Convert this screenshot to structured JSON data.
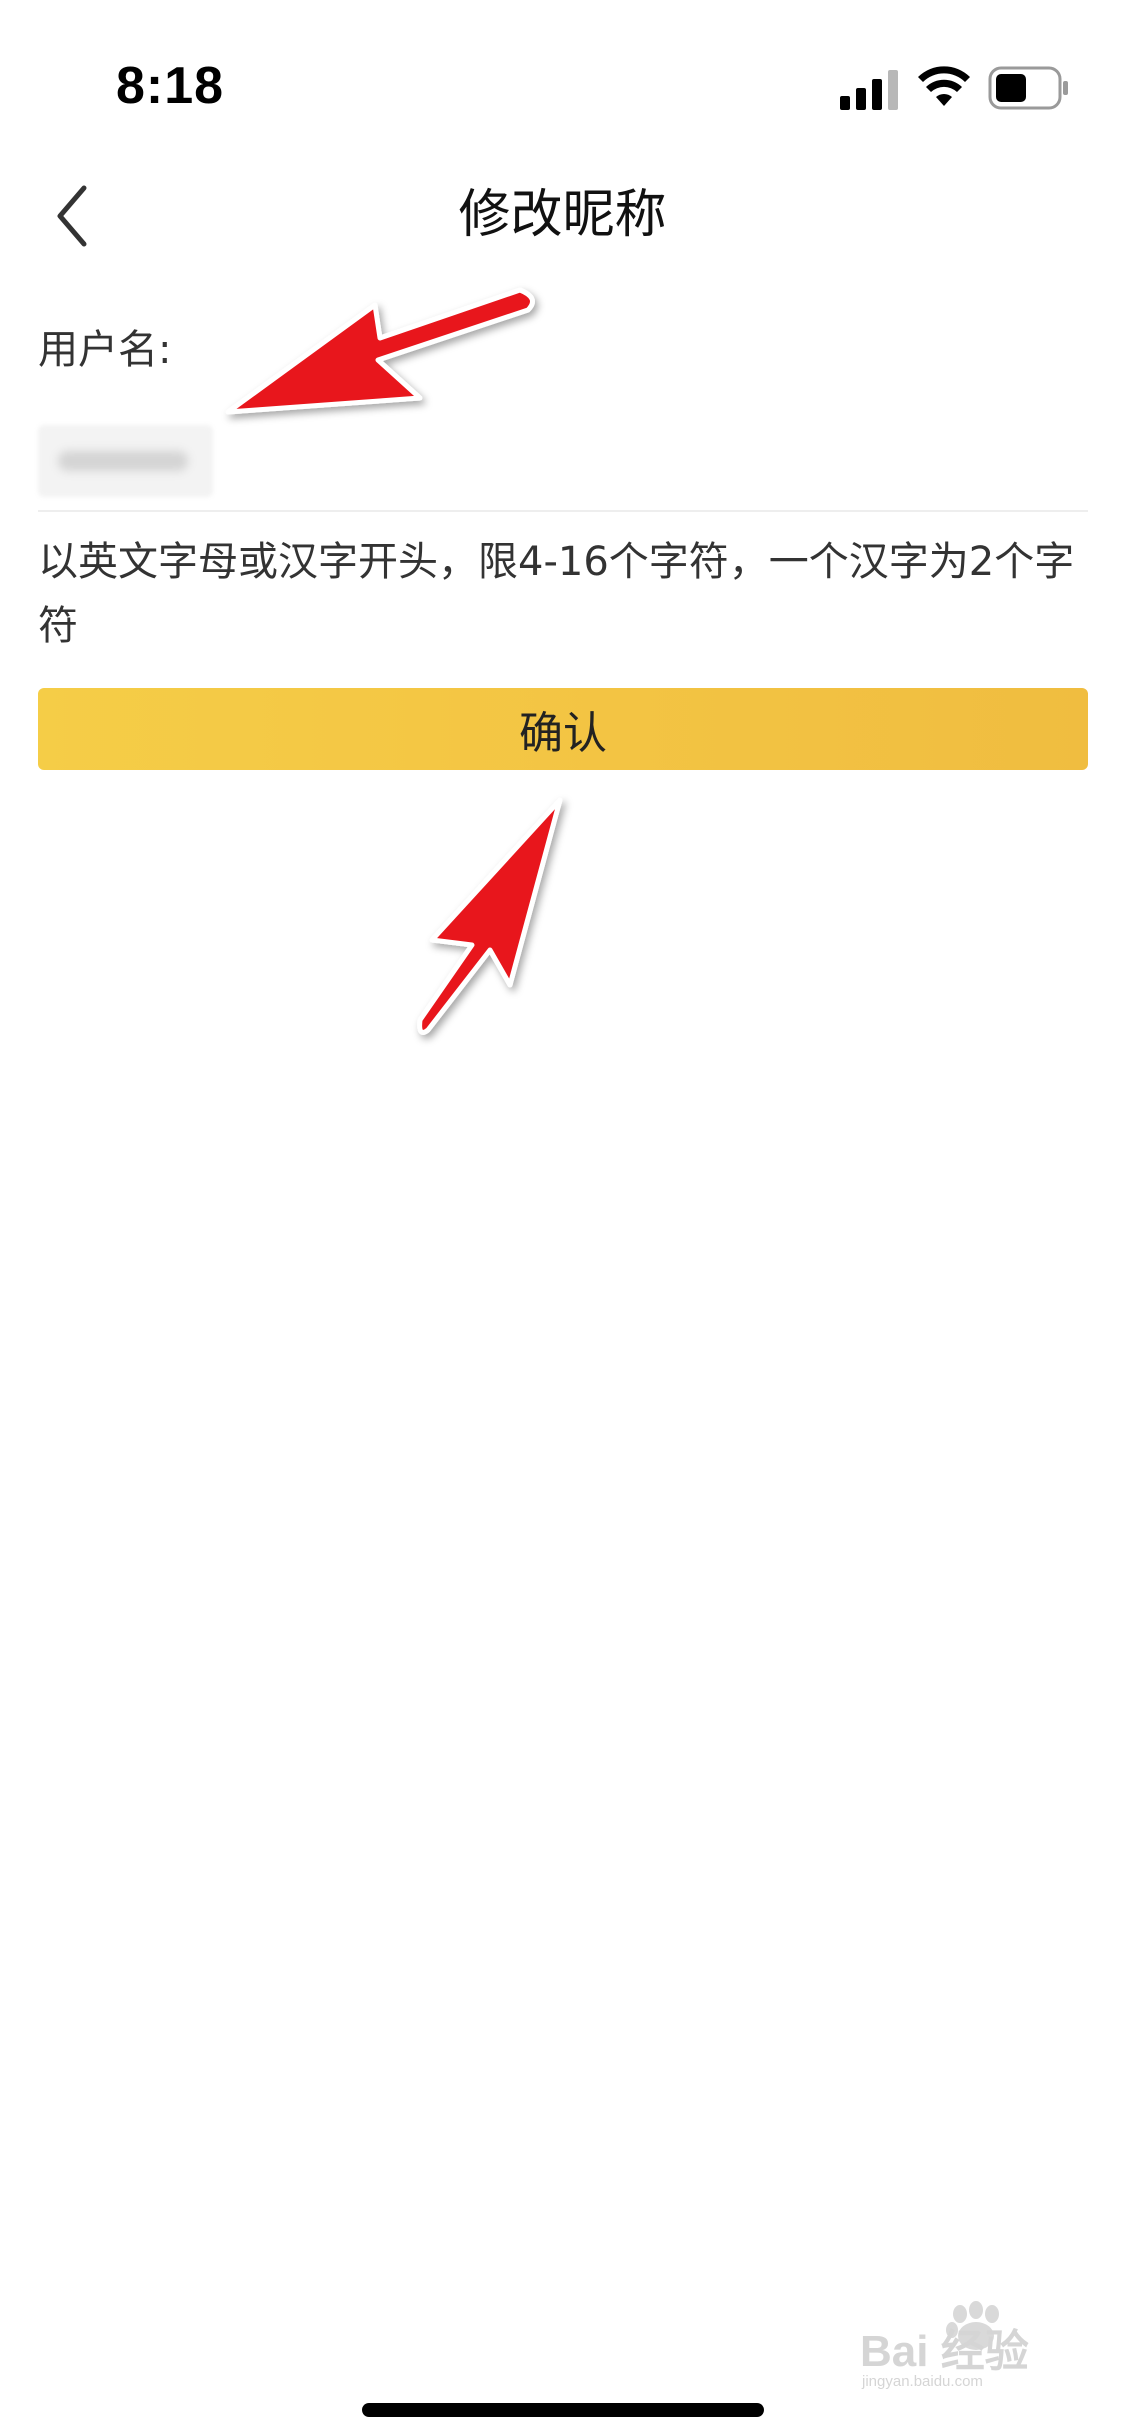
{
  "status_bar": {
    "time": "8:18",
    "signal_icon": "cellular-signal-icon",
    "wifi_icon": "wifi-icon",
    "battery_icon": "battery-icon"
  },
  "nav": {
    "back_icon": "chevron-left-icon",
    "title": "修改昵称"
  },
  "form": {
    "username_label": "用户名:",
    "username_value": "",
    "hint": "以英文字母或汉字开头，限4-16个字符，一个汉字为2个字符",
    "confirm_label": "确认"
  },
  "annotations": {
    "arrow_color": "#e8141b"
  },
  "watermark": {
    "text": "Bai 经验",
    "subtext": "jingyan.baidu.com"
  },
  "colors": {
    "confirm_button": "#f3c443",
    "background": "#ffffff"
  }
}
